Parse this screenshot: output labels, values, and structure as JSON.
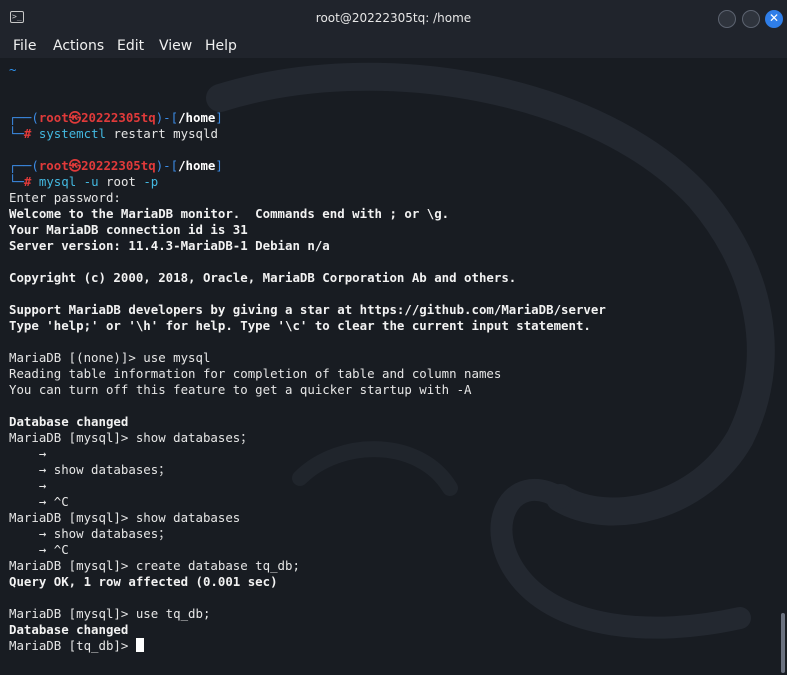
{
  "window": {
    "title": "root@20222305tq: /home",
    "minimize_symbol": "",
    "maximize_symbol": "",
    "close_symbol": "✕",
    "icon": "terminal-icon"
  },
  "menu": [
    "File",
    "Actions",
    "Edit",
    "View",
    "Help"
  ],
  "colors": {
    "background": "#181c22",
    "prompt_blue": "#3c8ce6",
    "prompt_red": "#e03a3a",
    "command": "#43b8e0",
    "close_button": "#2f7ee8"
  },
  "terminal": {
    "tilde": "~",
    "prompt1": {
      "top_open": "┌──(",
      "user": "root",
      "at": "㉿",
      "host": "20222305tq",
      "mid": ")-[",
      "path": "/home",
      "close": "]",
      "bottom": "└─",
      "hash": "#",
      "cmd": "systemctl",
      "args": "restart mysqld"
    },
    "prompt2": {
      "top_open": "┌──(",
      "user": "root",
      "at": "㉿",
      "host": "20222305tq",
      "mid": ")-[",
      "path": "/home",
      "close": "]",
      "bottom": "└─",
      "hash": "#",
      "cmd": "mysql",
      "flag_u": "-u",
      "user_arg": "root",
      "flag_p": "-p"
    },
    "output": [
      {
        "text": "Enter password:",
        "bold": false
      },
      {
        "text": "Welcome to the MariaDB monitor.  Commands end with ; or \\g.",
        "bold": true
      },
      {
        "text": "Your MariaDB connection id is 31",
        "bold": true
      },
      {
        "text": "Server version: 11.4.3-MariaDB-1 Debian n/a",
        "bold": true
      },
      {
        "text": "",
        "bold": false
      },
      {
        "text": "Copyright (c) 2000, 2018, Oracle, MariaDB Corporation Ab and others.",
        "bold": true
      },
      {
        "text": "",
        "bold": false
      },
      {
        "text": "Support MariaDB developers by giving a star at https://github.com/MariaDB/server",
        "bold": true
      },
      {
        "text": "Type 'help;' or '\\h' for help. Type '\\c' to clear the current input statement.",
        "bold": true
      },
      {
        "text": "",
        "bold": false
      },
      {
        "text": "MariaDB [(none)]> use mysql",
        "bold": false
      },
      {
        "text": "Reading table information for completion of table and column names",
        "bold": false
      },
      {
        "text": "You can turn off this feature to get a quicker startup with -A",
        "bold": false
      },
      {
        "text": "",
        "bold": false
      },
      {
        "text": "Database changed",
        "bold": true
      },
      {
        "text": "MariaDB [mysql]> show databases；",
        "bold": false
      },
      {
        "text": "    →",
        "bold": false
      },
      {
        "text": "    → show databases；",
        "bold": false
      },
      {
        "text": "    →",
        "bold": false
      },
      {
        "text": "    → ^C",
        "bold": false
      },
      {
        "text": "MariaDB [mysql]> show databases",
        "bold": false
      },
      {
        "text": "    → show databases；",
        "bold": false
      },
      {
        "text": "    → ^C",
        "bold": false
      },
      {
        "text": "MariaDB [mysql]> create database tq_db;",
        "bold": false
      },
      {
        "text": "Query OK, 1 row affected (0.001 sec)",
        "bold": true
      },
      {
        "text": "",
        "bold": false
      },
      {
        "text": "MariaDB [mysql]> use tq_db;",
        "bold": false
      },
      {
        "text": "Database changed",
        "bold": true
      }
    ],
    "final_prompt": "MariaDB [tq_db]> "
  }
}
